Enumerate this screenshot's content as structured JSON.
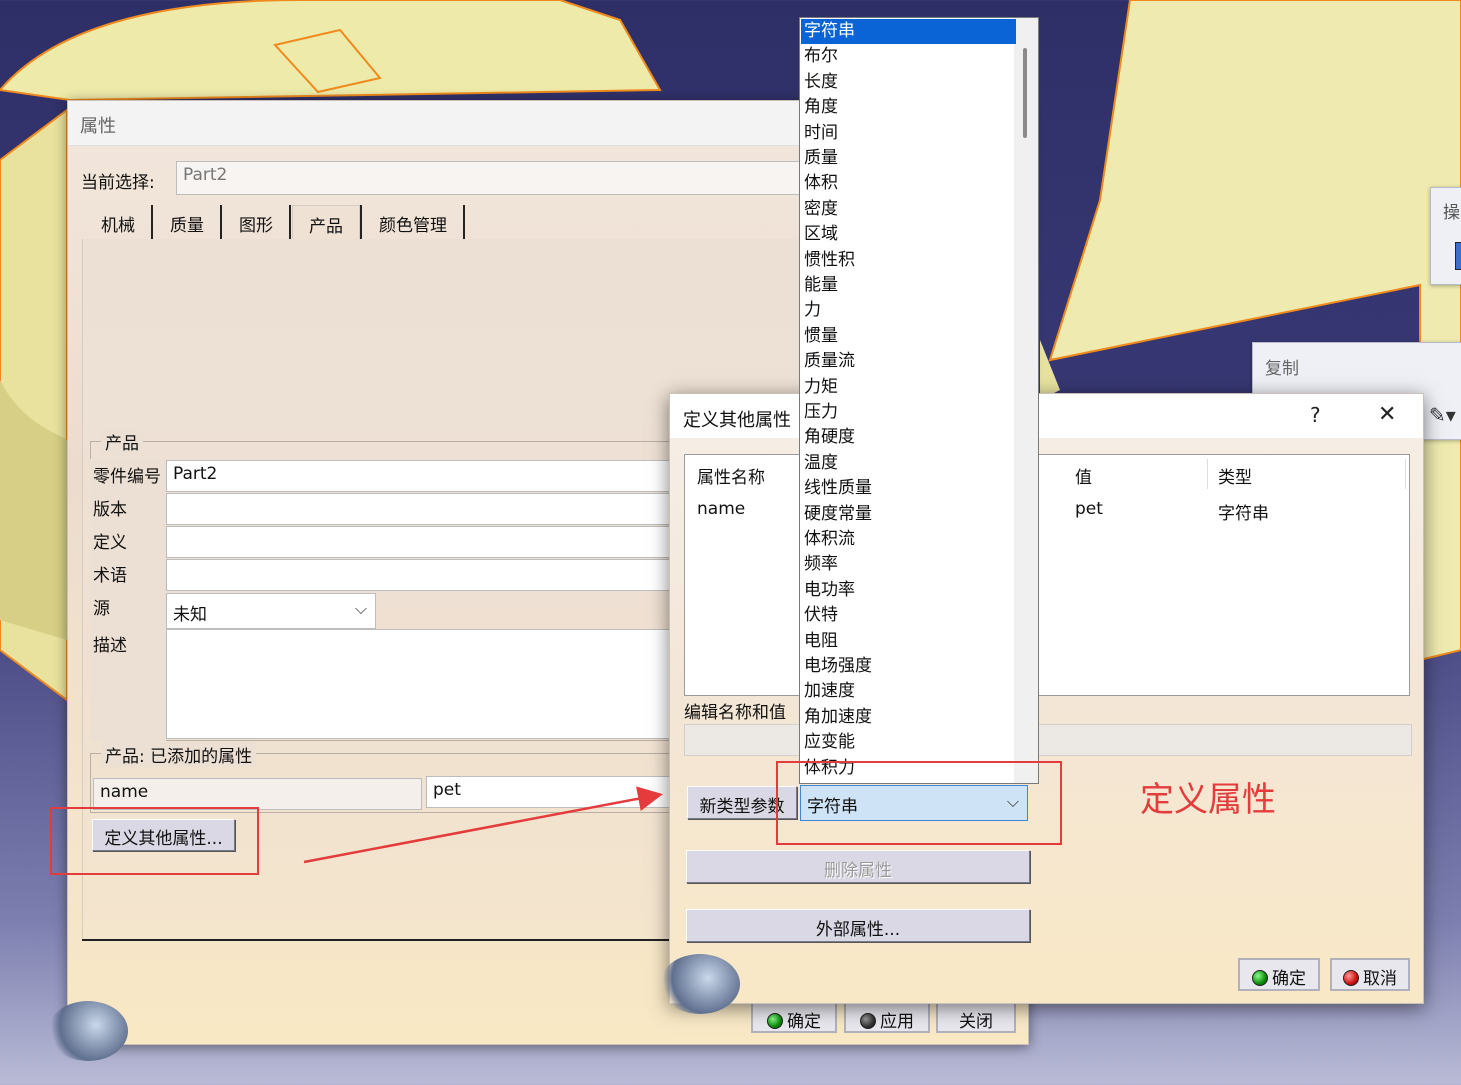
{
  "props_dialog": {
    "title": "属性",
    "current_selection_label": "当前选择:",
    "current_selection_value": "Part2",
    "tabs": [
      {
        "label": "机械"
      },
      {
        "label": "质量"
      },
      {
        "label": "图形"
      },
      {
        "label": "产品"
      },
      {
        "label": "颜色管理"
      }
    ],
    "active_tab": "产品",
    "product_group": {
      "legend": "产品",
      "fields": [
        {
          "label": "零件编号",
          "value": "Part2"
        },
        {
          "label": "版本",
          "value": ""
        },
        {
          "label": "定义",
          "value": ""
        },
        {
          "label": "术语",
          "value": ""
        },
        {
          "label": "源",
          "value": "未知"
        },
        {
          "label": "描述",
          "value": ""
        }
      ]
    },
    "added_props_group": {
      "legend": "产品: 已添加的属性",
      "name": "name",
      "value": "pet"
    },
    "define_other_button": "定义其他属性...",
    "buttons": {
      "ok": "确定",
      "apply": "应用",
      "close": "关闭"
    }
  },
  "define_dialog": {
    "title": "定义其他属性",
    "help": "?",
    "close": "✕",
    "table": {
      "headers": [
        "属性名称",
        "值",
        "类型"
      ],
      "rows": [
        {
          "name": "name",
          "value": "pet",
          "type": "字符串"
        }
      ]
    },
    "edit_label": "编辑名称和值",
    "new_param_button": "新类型参数",
    "type_select_value": "字符串",
    "delete_button": "删除属性",
    "external_button": "外部属性...",
    "ok": "确定",
    "cancel": "取消"
  },
  "type_list": [
    "字符串",
    "布尔",
    "长度",
    "角度",
    "时间",
    "质量",
    "体积",
    "密度",
    "区域",
    "惯性积",
    "能量",
    "力",
    "惯量",
    "质量流",
    "力矩",
    "压力",
    "角硬度",
    "温度",
    "线性质量",
    "硬度常量",
    "体积流",
    "频率",
    "电功率",
    "伏特",
    "电阻",
    "电场强度",
    "加速度",
    "角加速度",
    "应变能",
    "体积力"
  ],
  "annotation": {
    "text": "定义属性",
    "color": "#e43c3c"
  },
  "side_panels": {
    "top_right_label": "操",
    "copy_label": "复制"
  },
  "colors": {
    "background": "#34346e",
    "surface_yellow": "#f1efb0",
    "edge_orange": "#f08a1c",
    "selection_blue": "#0a64d6"
  }
}
